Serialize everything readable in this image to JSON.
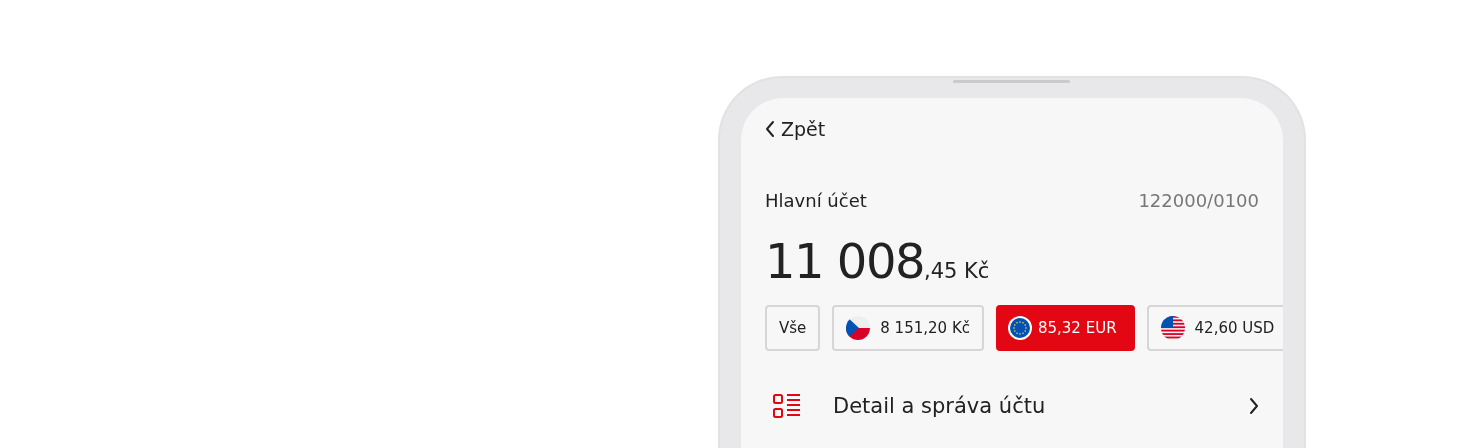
{
  "back": {
    "label": "Zpět"
  },
  "account": {
    "name": "Hlavní účet",
    "number": "122000/0100"
  },
  "balance": {
    "whole": "11 008",
    "fraction": ",45 Kč"
  },
  "currency_chips": [
    {
      "kind": "all",
      "label": "Vše",
      "selected": false
    },
    {
      "kind": "cz",
      "label": "8 151,20 Kč",
      "selected": false
    },
    {
      "kind": "eu",
      "label": "85,32 EUR",
      "selected": true
    },
    {
      "kind": "us",
      "label": "42,60 USD",
      "selected": false
    }
  ],
  "menu_items": [
    {
      "label": "Detail a správa účtu"
    }
  ]
}
